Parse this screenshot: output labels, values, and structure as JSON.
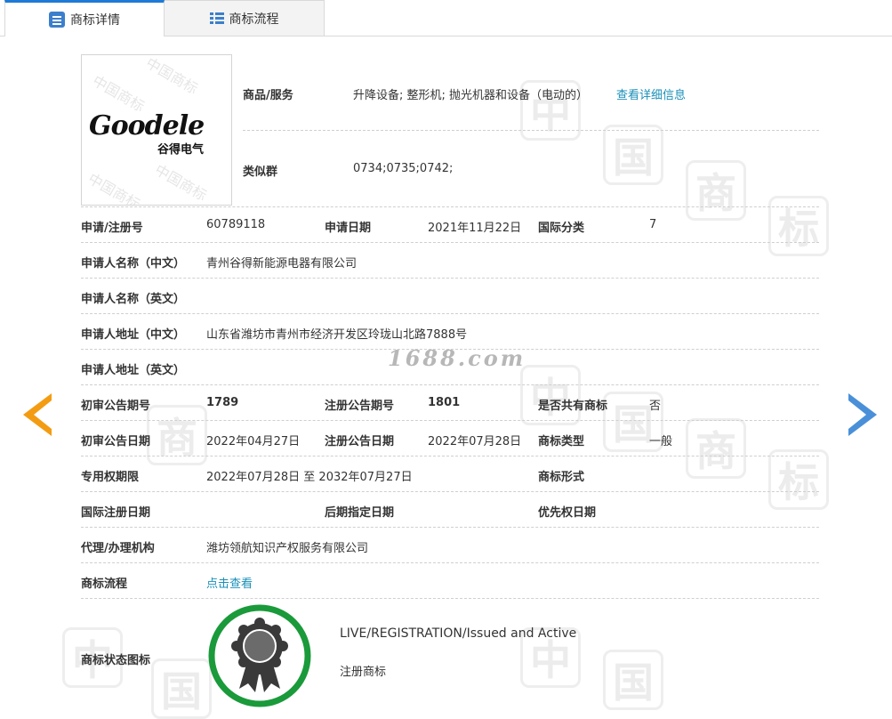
{
  "tabs": [
    {
      "label": "商标详情",
      "icon": "id-card-icon",
      "active": true
    },
    {
      "label": "商标流程",
      "icon": "list-icon",
      "active": false
    }
  ],
  "logo": {
    "wordmark": "Goodele",
    "chinese": "谷得电气",
    "watermark": "中国商标"
  },
  "goods_services": {
    "label": "商品/服务",
    "value": "升降设备; 整形机; 抛光机器和设备（电动的）",
    "link": "查看详细信息"
  },
  "similar_group": {
    "label": "类似群",
    "value": "0734;0735;0742;"
  },
  "rows": {
    "app_no": {
      "label": "申请/注册号",
      "value": "60789118"
    },
    "app_date": {
      "label": "申请日期",
      "value": "2021年11月22日"
    },
    "intl_class": {
      "label": "国际分类",
      "value": "7"
    },
    "applicant_cn": {
      "label": "申请人名称（中文）",
      "value": "青州谷得新能源电器有限公司"
    },
    "applicant_en": {
      "label": "申请人名称（英文）",
      "value": ""
    },
    "address_cn": {
      "label": "申请人地址（中文）",
      "value": "山东省潍坊市青州市经济开发区玲珑山北路7888号"
    },
    "address_en": {
      "label": "申请人地址（英文）",
      "value": ""
    },
    "prelim_issue_no": {
      "label": "初审公告期号",
      "value": "1789"
    },
    "reg_issue_no": {
      "label": "注册公告期号",
      "value": "1801"
    },
    "shared_mark": {
      "label": "是否共有商标",
      "value": "否"
    },
    "prelim_date": {
      "label": "初审公告日期",
      "value": "2022年04月27日"
    },
    "reg_date": {
      "label": "注册公告日期",
      "value": "2022年07月28日"
    },
    "mark_type": {
      "label": "商标类型",
      "value": "一般"
    },
    "exclusive_period": {
      "label": "专用权期限",
      "value": "2022年07月28日 至 2032年07月27日"
    },
    "mark_form": {
      "label": "商标形式",
      "value": ""
    },
    "intl_reg_date": {
      "label": "国际注册日期",
      "value": ""
    },
    "later_designation_date": {
      "label": "后期指定日期",
      "value": ""
    },
    "priority_date": {
      "label": "优先权日期",
      "value": ""
    },
    "agent": {
      "label": "代理/办理机构",
      "value": "潍坊领航知识产权服务有限公司"
    },
    "process": {
      "label": "商标流程",
      "link": "点击查看"
    }
  },
  "status": {
    "label": "商标状态图标",
    "en": "LIVE/REGISTRATION/Issued and Active",
    "cn": "注册商标",
    "icon": "award-ribbon-icon",
    "ring_color": "#1a9a3a"
  },
  "watermark_text": "1688.com",
  "watermark_chars": [
    "中",
    "国",
    "商",
    "标"
  ],
  "nav": {
    "prev_color": "#f39c12",
    "next_color": "#4a90d9"
  }
}
